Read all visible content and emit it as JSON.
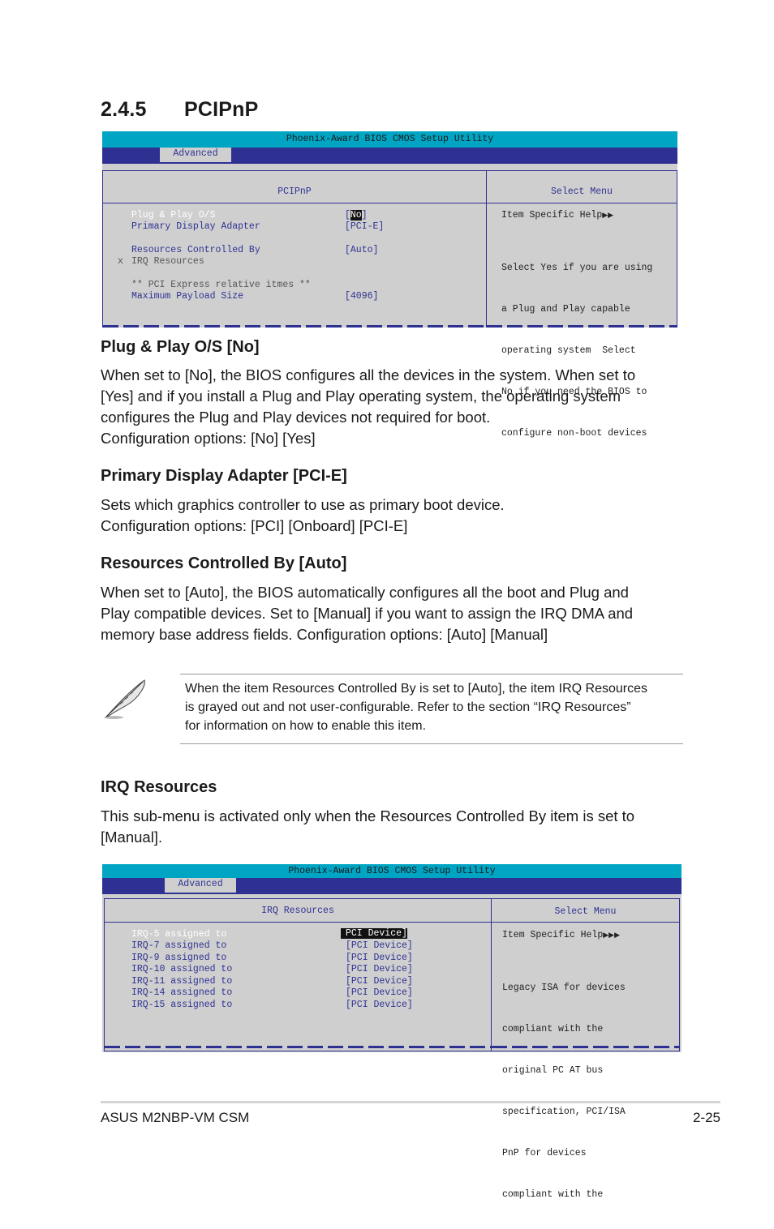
{
  "section": {
    "number": "2.4.5",
    "title": "PCIPnP"
  },
  "bios1": {
    "title": "Phoenix-Award BIOS CMOS Setup Utility",
    "tab": "Advanced",
    "panel_title": "PCIPnP",
    "help_title": "Select Menu",
    "items": [
      {
        "mark": "",
        "label": "Plug & Play O/S",
        "value": "[No]",
        "selected": true
      },
      {
        "mark": "",
        "label": "Primary Display Adapter",
        "value": "[PCI-E]"
      },
      {
        "mark": "",
        "label": "Resources Controlled By",
        "value": "[Auto]"
      },
      {
        "mark": "x",
        "label": "IRQ Resources",
        "value": "",
        "disabled": true
      },
      {
        "mark": "",
        "label": "** PCI Express relative itmes **",
        "value": "",
        "disabled": true
      },
      {
        "mark": "",
        "label": "Maximum Payload Size",
        "value": "[4096]"
      }
    ],
    "help_heading": "Item Specific Help",
    "help_arrows": "▶▶",
    "help_lines": [
      "Select Yes if you are using",
      "a Plug and Play capable",
      "operating system  Select",
      "No if you need the BIOS to",
      "configure non-boot devices"
    ]
  },
  "plug_play": {
    "heading": "Plug & Play O/S [No]",
    "lines": [
      "When set to [No], the BIOS configures all the devices in the system. When set to",
      "[Yes] and if you install a Plug and Play operating system, the operating system",
      "configures the Plug and Play devices not required for boot.",
      "Configuration options: [No] [Yes]"
    ]
  },
  "primary_display": {
    "heading": "Primary Display Adapter [PCI-E]",
    "lines": [
      "Sets which graphics controller to use as primary boot device.",
      "Configuration options: [PCI] [Onboard] [PCI-E]"
    ]
  },
  "resources": {
    "heading": "Resources Controlled By [Auto]",
    "lines": [
      "When set to [Auto], the BIOS automatically configures all the boot and Plug and",
      "Play compatible devices. Set to [Manual] if you want to assign the IRQ DMA and",
      "memory base address fields. Configuration options: [Auto] [Manual]"
    ]
  },
  "note": {
    "icon": "feather-pen-icon",
    "lines": [
      "When the item Resources Controlled By is set to [Auto], the item IRQ Resources",
      "is grayed out and not user-configurable. Refer to the section “IRQ Resources”",
      "for information on how to enable this item."
    ]
  },
  "irq": {
    "heading": "IRQ Resources",
    "lines": [
      "This sub-menu is activated only when the Resources Controlled By item is set to",
      "[Manual]."
    ]
  },
  "bios2": {
    "title": "Phoenix-Award BIOS CMOS Setup Utility",
    "tab": "Advanced",
    "panel_title": "IRQ Resources",
    "help_title": "Select Menu",
    "items": [
      {
        "label": "IRQ-5 assigned to",
        "value": "[PCI Device]",
        "selected": true
      },
      {
        "label": "IRQ-7 assigned to",
        "value": "[PCI Device]"
      },
      {
        "label": "IRQ-9 assigned to",
        "value": "[PCI Device]"
      },
      {
        "label": "IRQ-10 assigned to",
        "value": "[PCI Device]"
      },
      {
        "label": "IRQ-11 assigned to",
        "value": "[PCI Device]"
      },
      {
        "label": "IRQ-14 assigned to",
        "value": "[PCI Device]"
      },
      {
        "label": "IRQ-15 assigned to",
        "value": "[PCI Device]"
      }
    ],
    "help_heading": "Item Specific Help",
    "help_arrows": "▶▶▶",
    "help_lines": [
      "Legacy ISA for devices",
      "compliant with the",
      "original PC AT bus",
      "specification, PCI/ISA",
      "PnP for devices",
      "compliant with the"
    ]
  },
  "footer": {
    "left": "ASUS M2NBP-VM CSM",
    "right": "2-25"
  }
}
